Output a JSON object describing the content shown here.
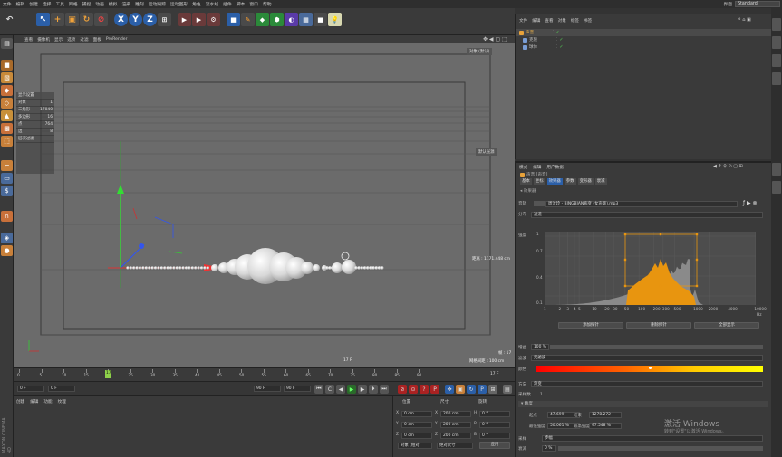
{
  "menubar": {
    "items": [
      "文件",
      "编辑",
      "创建",
      "选择",
      "工具",
      "网格",
      "捕捉",
      "动画",
      "模拟",
      "渲染",
      "雕刻",
      "运动跟踪",
      "运动图形",
      "角色",
      "流水线",
      "插件",
      "脚本",
      "窗口",
      "帮助"
    ],
    "layout_label": "界面",
    "layout_value": "Standard"
  },
  "viewport_menu": [
    "查看",
    "摄像机",
    "显示",
    "选项",
    "过滤",
    "面板",
    "ProRender"
  ],
  "viewport": {
    "hud_title": "显示设置",
    "hud_rows": [
      "对象",
      "三角形",
      "多边形",
      "点",
      "边",
      "层次过滤"
    ],
    "hud_values": [
      "1",
      "17040",
      "16",
      "764",
      "8",
      ""
    ],
    "right_label": "默认光源",
    "distance_label": "距离 : 1171.448 cm",
    "frame_label": "帧 : 17",
    "grid_label": "网格间距 : 100 cm",
    "fps_label": "17 F",
    "top_right": "对象 (默认)"
  },
  "timeline": {
    "ticks": [
      "0",
      "5",
      "10",
      "15",
      "20",
      "25",
      "30",
      "35",
      "40",
      "45",
      "50",
      "55",
      "60",
      "65",
      "70",
      "75",
      "80",
      "85",
      "90"
    ],
    "current": "17",
    "end_label": "17 F"
  },
  "transport": {
    "start": "0 F",
    "current": "0 F",
    "end": "90 F",
    "end2": "90 F"
  },
  "material": {
    "menu": [
      "创建",
      "编辑",
      "功能",
      "纹理"
    ]
  },
  "coords": {
    "headers": [
      "位置",
      "尺寸",
      "旋转"
    ],
    "rows": [
      {
        "axis": "X",
        "pos": "0 cm",
        "size": "200 cm",
        "rot_axis": "H",
        "rot": "0 °"
      },
      {
        "axis": "Y",
        "pos": "0 cm",
        "size": "200 cm",
        "rot_axis": "P",
        "rot": "0 °"
      },
      {
        "axis": "Z",
        "pos": "0 cm",
        "size": "200 cm",
        "rot_axis": "B",
        "rot": "0 °"
      }
    ],
    "mode": "对象 (相对)",
    "size_mode": "绝对尺寸",
    "apply": "应用"
  },
  "object_manager": {
    "menu": [
      "文件",
      "编辑",
      "查看",
      "对象",
      "标签",
      "书签"
    ],
    "objects": [
      {
        "name": "声音",
        "color": "#e8a23a"
      },
      {
        "name": "克隆",
        "color": "#7a9ed6"
      },
      {
        "name": "球体",
        "color": "#7a9ed6"
      }
    ]
  },
  "attributes": {
    "menu": [
      "模式",
      "编辑",
      "用户数据"
    ],
    "object_title": "声音 [声音]",
    "tabs": [
      "基本",
      "坐标",
      "效果器",
      "参数",
      "变形器",
      "衰减"
    ],
    "section": "效果器",
    "sound_label": "音轨",
    "sound_file": "周汶玲 - BINGBIAN病变 (女声版).mp3",
    "channel_label": "分布",
    "channel_value": "通道",
    "graph_y_label": "强度",
    "graph_y_ticks": [
      "1",
      "0.7",
      "0.4",
      "0.1"
    ],
    "graph_x_ticks": [
      "1",
      "2",
      "3",
      "4",
      "5",
      "10",
      "20",
      "30",
      "50",
      "100",
      "200",
      "300",
      "500",
      "1000",
      "2000",
      "4000",
      "10000"
    ],
    "graph_unit": "Hz",
    "graph_buttons": [
      "添加探针",
      "删除探针",
      "全部显示"
    ],
    "strength_label": "增益",
    "strength_value": "100 %",
    "filter_label": "滤波",
    "filter_value": "无滤波",
    "color_label": "颜色",
    "direction_label": "方向",
    "direction_value": "渐变",
    "samples_label": "采样数",
    "samples_value": "1",
    "section2": "精度",
    "coord_rows": [
      {
        "l1": "起点",
        "v1": "47.699",
        "l2": "结束",
        "v2": "1278.272"
      },
      {
        "l1": "最低强度",
        "v1": "50.061 %",
        "l2": "最高强度",
        "v2": "97.548 %"
      }
    ],
    "mode_label": "采样",
    "mode_value": "步幅",
    "attack_label": "衰减",
    "attack_value": "0 %"
  },
  "watermark": {
    "title": "激活 Windows",
    "subtitle": "转到\"设置\"以激活 Windows。"
  },
  "colors": {
    "bg_dark": "#333333",
    "viewport": "#6b6b6b",
    "accent_green": "#8ed14a",
    "graph_orange": "#e8950f"
  }
}
